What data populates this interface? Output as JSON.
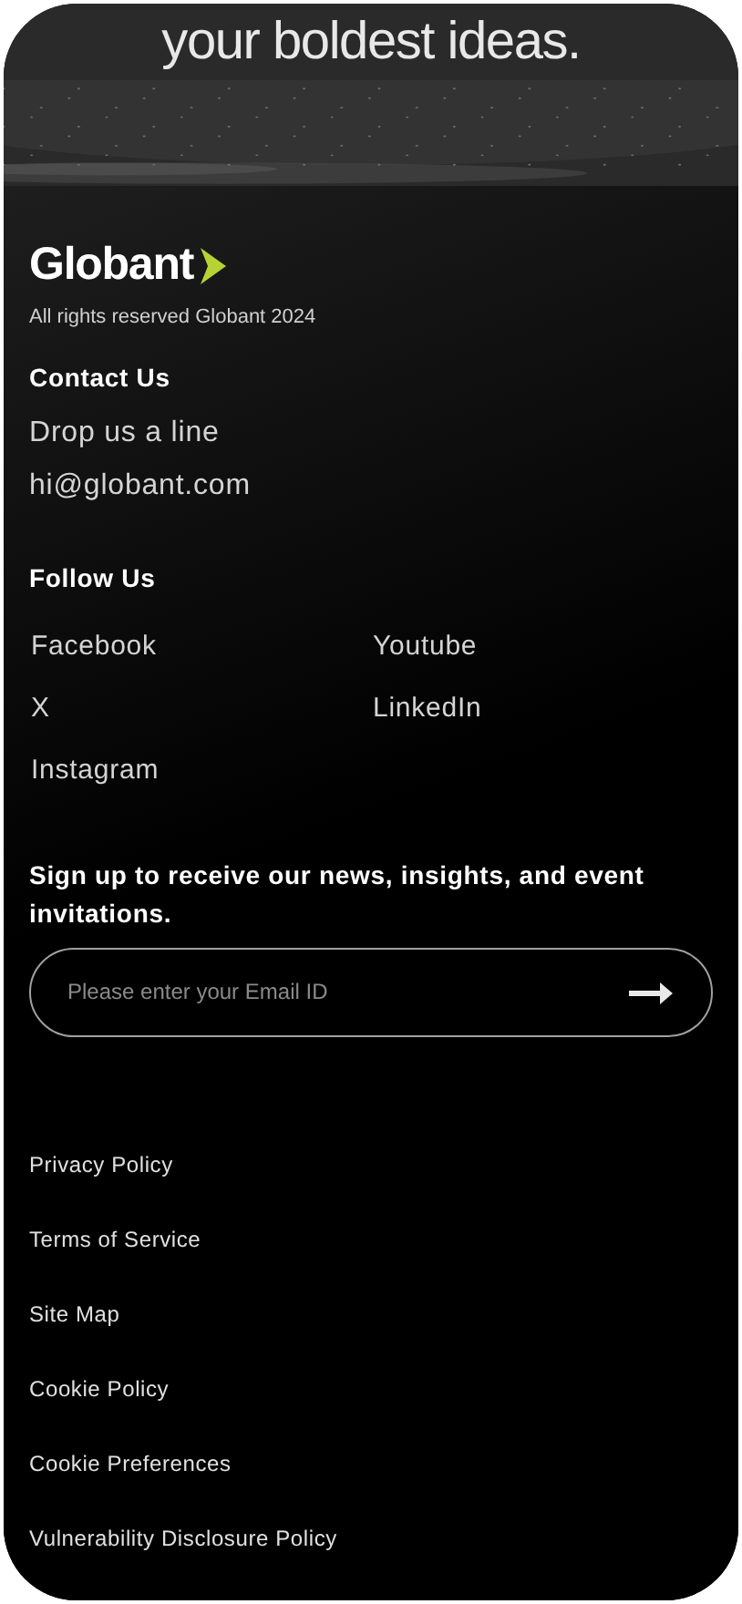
{
  "hero": {
    "headline": "your boldest ideas.",
    "kind": "picture"
  },
  "brand": {
    "logo_text": "Globant",
    "copyright": "All rights reserved Globant 2024"
  },
  "contact": {
    "heading": "Contact Us",
    "lines": [
      "Drop us a line",
      "hi@globant.com"
    ]
  },
  "follow": {
    "heading": "Follow Us",
    "links": [
      "Facebook",
      "Youtube",
      "X",
      "LinkedIn",
      "Instagram"
    ]
  },
  "newsletter": {
    "prompt": "Sign up to receive our news, insights, and event invitations.",
    "placeholder": "Please enter your Email ID"
  },
  "legal_links": [
    "Privacy Policy",
    "Terms of Service",
    "Site Map",
    "Cookie Policy",
    "Cookie Preferences",
    "Vulnerability Disclosure Policy"
  ]
}
